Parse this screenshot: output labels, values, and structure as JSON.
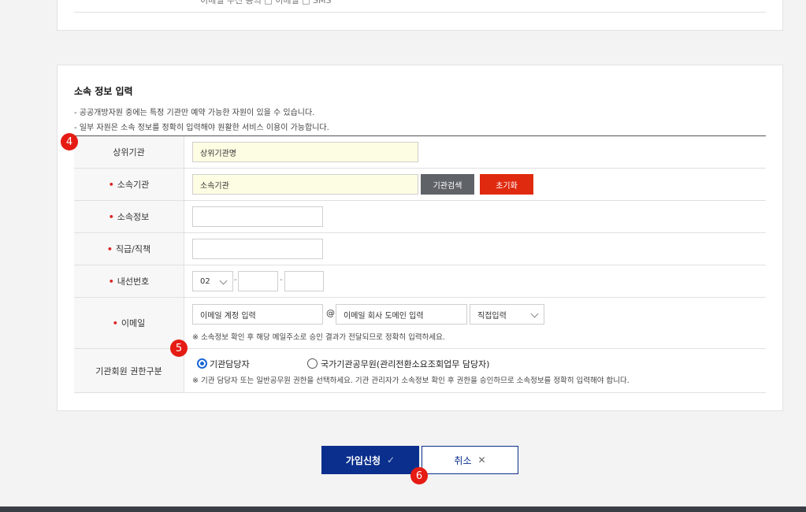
{
  "top_panel": {
    "cut_text": "이메일 수신 동의  □ 이메일  □ SMS"
  },
  "section": {
    "title": "소속 정보 입력",
    "notes": [
      "- 공공개방자원 중에는 특정 기관만 예약 가능한 자원이 있을 수 있습니다.",
      "- 일부 자원은 소속 정보를 정확히 입력해야 원활한 서비스 이용이 가능합니다."
    ]
  },
  "form": {
    "parent_org": {
      "label": "상위기관",
      "value": "상위기관명"
    },
    "org": {
      "label": "소속기관",
      "value": "소속기관",
      "search_label": "기관검색",
      "reset_label": "초기화"
    },
    "dept": {
      "label": "소속정보"
    },
    "position": {
      "label": "직급/직책"
    },
    "phone": {
      "label": "내선번호",
      "area_code": "02",
      "sep": "-"
    },
    "email": {
      "label": "이메일",
      "account_placeholder": "이메일 계정 입력",
      "at": "@",
      "domain_placeholder": "이메일 회사 도메인 입력",
      "domain_select": "직접입력",
      "note": "※ 소속정보 확인 후 해당 메일주소로 승인 결과가 전달되므로 정확히 입력하세요."
    },
    "role": {
      "label": "기관회원 권한구분",
      "option1": "기관담당자",
      "option2": "국가기관공무원(관리전환소요조회업무 담당자)",
      "note": "※ 기관 담당자 또는 일반공무원 권한을 선택하세요. 기관 관리자가 소속정보 확인 후 권한을 승인하므로 소속정보를 정확히 입력해야 합니다."
    },
    "required_mark": "•"
  },
  "markers": {
    "m4": "4",
    "m5": "5",
    "m6": "6"
  },
  "buttons": {
    "submit": "가입신청",
    "submit_icon": "✓",
    "cancel": "취소",
    "cancel_icon": "✕"
  }
}
